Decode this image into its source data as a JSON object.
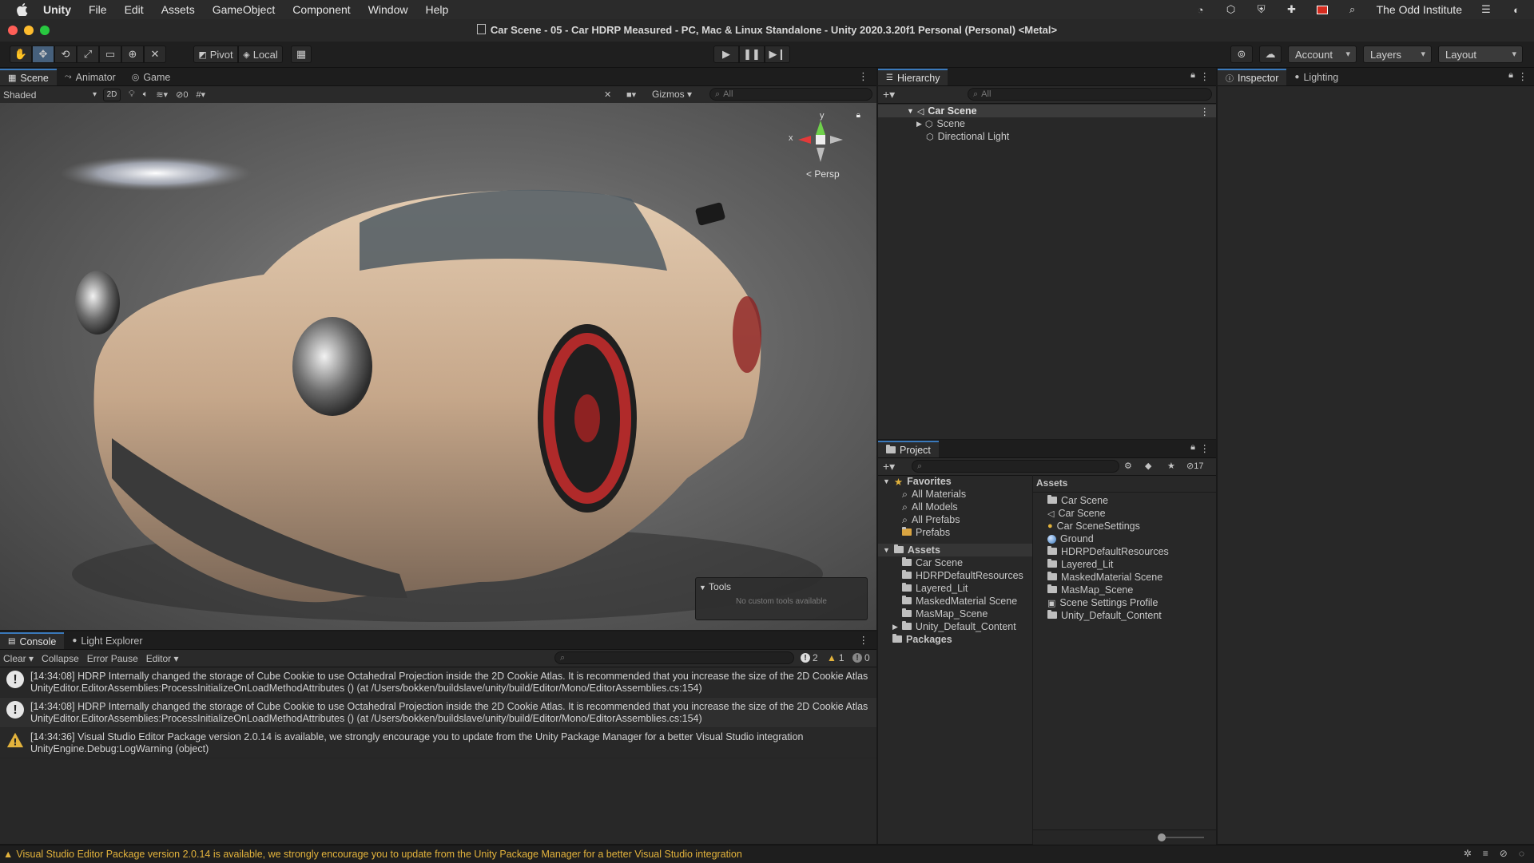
{
  "menubar": {
    "app": "Unity",
    "items": [
      "File",
      "Edit",
      "Assets",
      "GameObject",
      "Component",
      "Window",
      "Help"
    ],
    "org": "The Odd Institute"
  },
  "title": "Car Scene - 05 - Car HDRP Measured - PC, Mac & Linux Standalone - Unity 2020.3.20f1 Personal (Personal) <Metal>",
  "toolbar": {
    "pivot": "Pivot",
    "local": "Local",
    "account": "Account",
    "layers": "Layers",
    "layout": "Layout"
  },
  "scene_panel": {
    "tabs": [
      "Scene",
      "Animator",
      "Game"
    ],
    "shading": "Shaded",
    "mode_2d": "2D",
    "hidden_count": "0",
    "gizmos": "Gizmos",
    "search_placeholder": "All",
    "gizmo_y": "y",
    "gizmo_x": "x",
    "persp": "Persp",
    "tools_title": "Tools",
    "tools_empty": "No custom tools available"
  },
  "hierarchy": {
    "tab": "Hierarchy",
    "search_placeholder": "All",
    "items": [
      {
        "label": "Car Scene",
        "depth": 0
      },
      {
        "label": "Scene",
        "depth": 1
      },
      {
        "label": "Directional Light",
        "depth": 1
      }
    ]
  },
  "inspector": {
    "tabs": [
      "Inspector",
      "Lighting"
    ]
  },
  "project": {
    "tab": "Project",
    "hidden_count": "17",
    "favorites_label": "Favorites",
    "favorites": [
      "All Materials",
      "All Models",
      "All Prefabs",
      "Prefabs"
    ],
    "assets_label": "Assets",
    "asset_folders": [
      "Car Scene",
      "HDRPDefaultResources",
      "Layered_Lit",
      "MaskedMaterial Scene",
      "MasMap_Scene",
      "Unity_Default_Content"
    ],
    "packages_label": "Packages",
    "right_header": "Assets",
    "right_items": [
      {
        "label": "Car Scene",
        "icon": "folder"
      },
      {
        "label": "Car Scene",
        "icon": "unity-scene"
      },
      {
        "label": "Car SceneSettings",
        "icon": "settings"
      },
      {
        "label": "Ground",
        "icon": "material"
      },
      {
        "label": "HDRPDefaultResources",
        "icon": "folder"
      },
      {
        "label": "Layered_Lit",
        "icon": "folder"
      },
      {
        "label": "MaskedMaterial Scene",
        "icon": "folder"
      },
      {
        "label": "MasMap_Scene",
        "icon": "folder"
      },
      {
        "label": "Scene Settings Profile",
        "icon": "profile"
      },
      {
        "label": "Unity_Default_Content",
        "icon": "folder"
      }
    ]
  },
  "console": {
    "tabs": [
      "Console",
      "Light Explorer"
    ],
    "clear": "Clear",
    "collapse": "Collapse",
    "error_pause": "Error Pause",
    "editor": "Editor",
    "count_info": "2",
    "count_warn": "1",
    "count_err": "0",
    "logs": [
      {
        "type": "info",
        "line1": "[14:34:08] HDRP Internally changed the storage of Cube Cookie to use Octahedral Projection inside the 2D Cookie Atlas. It is recommended that you increase the size of the 2D Cookie Atlas",
        "line2": "UnityEditor.EditorAssemblies:ProcessInitializeOnLoadMethodAttributes () (at /Users/bokken/buildslave/unity/build/Editor/Mono/EditorAssemblies.cs:154)"
      },
      {
        "type": "info",
        "line1": "[14:34:08] HDRP Internally changed the storage of Cube Cookie to use Octahedral Projection inside the 2D Cookie Atlas. It is recommended that you increase the size of the 2D Cookie Atlas",
        "line2": "UnityEditor.EditorAssemblies:ProcessInitializeOnLoadMethodAttributes () (at /Users/bokken/buildslave/unity/build/Editor/Mono/EditorAssemblies.cs:154)"
      },
      {
        "type": "warning",
        "line1": "[14:34:36] Visual Studio Editor Package version 2.0.14 is available, we strongly encourage you to update from the Unity Package Manager for a better Visual Studio integration",
        "line2": "UnityEngine.Debug:LogWarning (object)"
      }
    ]
  },
  "status": "Visual Studio Editor Package version 2.0.14 is available, we strongly encourage you to update from the Unity Package Manager for a better Visual Studio integration",
  "colors": {
    "accent": "#3a79bb",
    "warning": "#e3b33c",
    "car_body": "#c8a98a",
    "wheel": "#b02a2a"
  }
}
